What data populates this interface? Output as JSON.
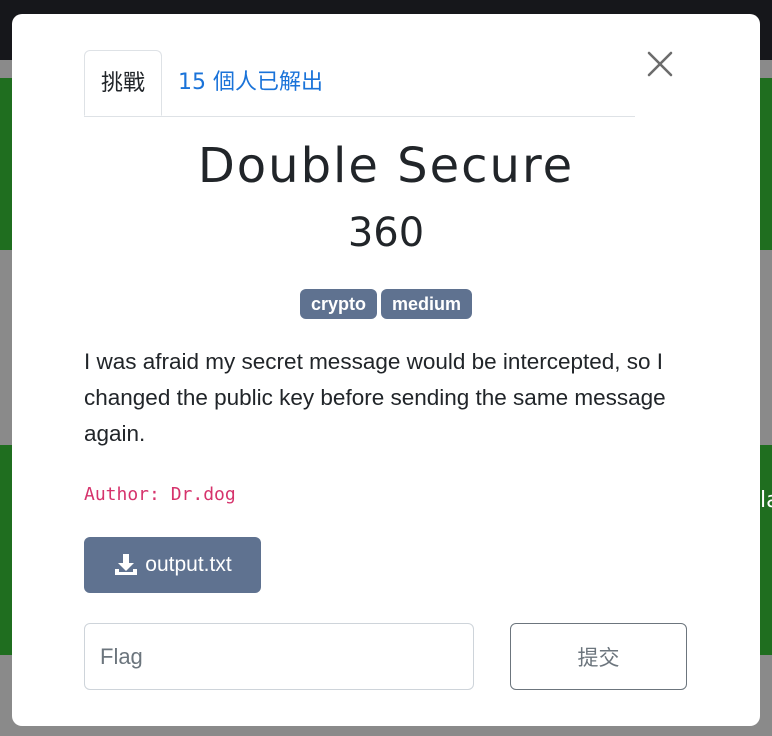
{
  "background": {
    "peek_text": "la"
  },
  "modal": {
    "tabs": {
      "challenge": "挑戰",
      "solves": "15 個人已解出"
    },
    "close_icon": "close-icon",
    "title": "Double Secure",
    "points": "360",
    "tags": [
      "crypto",
      "medium"
    ],
    "description": "I was afraid my secret message would be intercepted, so I changed the public key before sending the same message again.",
    "author": "Author: Dr.dog",
    "file": {
      "icon": "download-icon",
      "label": "output.txt"
    },
    "flag_input": {
      "placeholder": "Flag",
      "value": ""
    },
    "submit_label": "提交"
  },
  "colors": {
    "tag": "#5f7290",
    "link": "#1a73d9",
    "author": "#d6336c",
    "green_bg": "#1f6e1f"
  }
}
